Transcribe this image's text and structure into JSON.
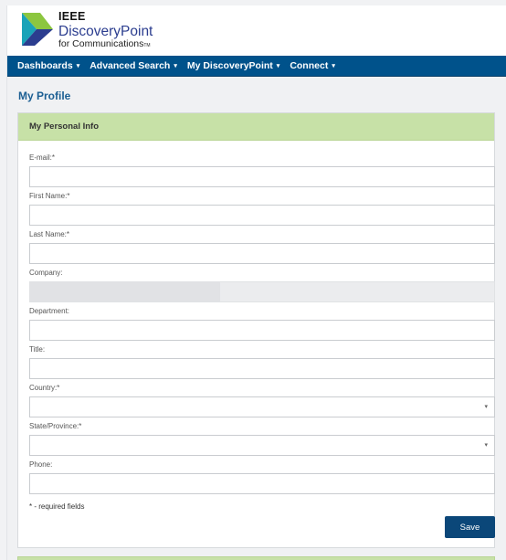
{
  "brand": {
    "ieee": "IEEE",
    "product": "DiscoveryPoint",
    "tagline": "for Communications",
    "tm": "TM",
    "colors": {
      "dark_blue": "#2b3d8f",
      "teal": "#1aa3b8",
      "green": "#8cc63f"
    }
  },
  "nav": {
    "items": [
      {
        "label": "Dashboards",
        "caret": "▾"
      },
      {
        "label": "Advanced Search",
        "caret": "▾"
      },
      {
        "label": "My DiscoveryPoint",
        "caret": "▾"
      },
      {
        "label": "Connect",
        "caret": "▾"
      }
    ]
  },
  "page": {
    "title": "My Profile"
  },
  "panel": {
    "title": "My Personal Info",
    "fields": [
      {
        "label": "E-mail:*",
        "value": ""
      },
      {
        "label": "First Name:*",
        "value": ""
      },
      {
        "label": "Last Name:*",
        "value": ""
      },
      {
        "label": "Company:",
        "value": ""
      },
      {
        "label": "Department:",
        "value": ""
      },
      {
        "label": "Title:",
        "value": ""
      },
      {
        "label": "Country:*",
        "value": ""
      },
      {
        "label": "State/Province:*",
        "value": ""
      },
      {
        "label": "Phone:",
        "value": ""
      }
    ],
    "required_note": "* - required fields",
    "save_label": "Save",
    "dropdown_icon": "▾"
  },
  "colors": {
    "nav_bg": "#00528b",
    "panel_header_bg": "#c7e1a7",
    "title_color": "#1c5f93",
    "save_bg": "#0b4779"
  }
}
